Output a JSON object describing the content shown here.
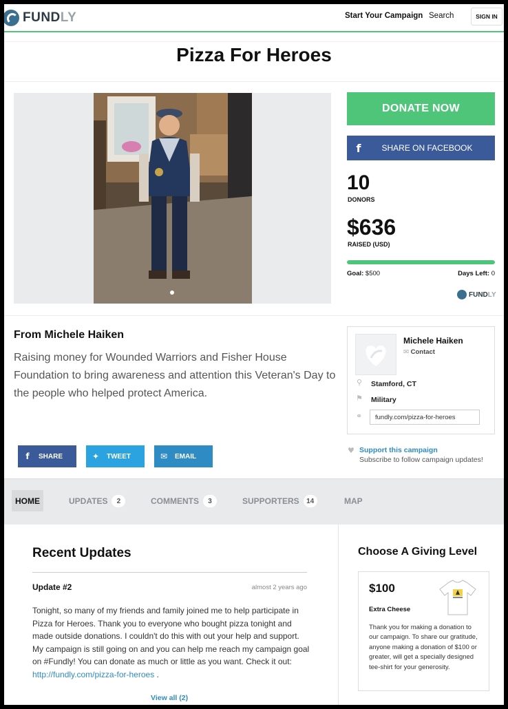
{
  "header": {
    "logo_text": "FUNDLY",
    "nav_start": "Start Your Campaign",
    "nav_search": "Search",
    "nav_signin": "SIGN IN"
  },
  "campaign": {
    "title": "Pizza For Heroes",
    "donate_label": "DONATE NOW",
    "share_facebook_label": "SHARE ON FACEBOOK",
    "donors_count": "10",
    "donors_label": "DONORS",
    "raised_amount": "$636",
    "raised_label": "RAISED (USD)",
    "progress_percent": 100,
    "goal_label": "Goal:",
    "goal_value": "$500",
    "days_left_label": "Days Left:",
    "days_left_value": "0",
    "powered_logo": "FUNDLY"
  },
  "about": {
    "from_label": "From Michele Haiken",
    "description": "Raising money for Wounded Warriors and Fisher House Foundation to bring awareness and attention this Veteran's Day to the people who helped protect America."
  },
  "owner": {
    "name": "Michele Haiken",
    "contact_label": "Contact",
    "location": "Stamford, CT",
    "category": "Military",
    "url": "fundly.com/pizza-for-heroes"
  },
  "share_buttons": {
    "share": "SHARE",
    "tweet": "TWEET",
    "email": "EMAIL"
  },
  "support": {
    "link": "Support this campaign",
    "subtext": "Subscribe to follow campaign updates!"
  },
  "tabs": {
    "home": "HOME",
    "updates": "UPDATES",
    "updates_count": "2",
    "comments": "COMMENTS",
    "comments_count": "3",
    "supporters": "SUPPORTERS",
    "supporters_count": "14",
    "map": "MAP"
  },
  "updates": {
    "heading": "Recent Updates",
    "item_title": "Update #2",
    "item_time": "almost 2 years ago",
    "item_body": "Tonight, so many of my friends and family joined me to help participate in Pizza for Heroes. Thank you to everyone who bought pizza tonight and made outside donations. I couldn't do this with out your help and support. My campaign is still going on and you can help me reach my campaign goal on #Fundly! You can donate as much or little as you want. Check it out: ",
    "item_link": "http://fundly.com/pizza-for-heroes",
    "item_end": " .",
    "view_all": "View all (2)"
  },
  "giving": {
    "heading": "Choose A Giving Level",
    "amount": "$100",
    "name": "Extra Cheese",
    "description": "Thank you for making a donation to our campaign. To share our gratitude, anyone making a donation of $100 or greater, will get a specially designed tee-shirt for your generosity."
  },
  "colors": {
    "green": "#4fc57a",
    "facebook": "#3b5a99",
    "twitter": "#2aa3e0",
    "link_blue": "#2f8bc3"
  }
}
